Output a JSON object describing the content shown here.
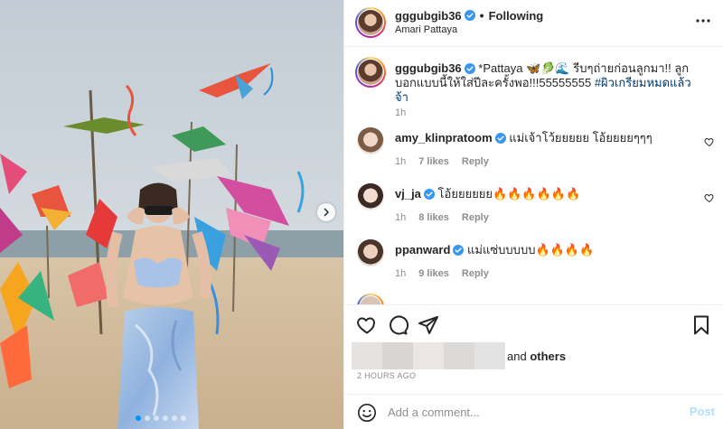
{
  "header": {
    "username": "gggubgib36",
    "separator": "•",
    "follow_status": "Following",
    "location": "Amari Pattaya"
  },
  "caption": {
    "username": "gggubgib36",
    "text": "*Pattaya 🦋🥬🌊 รีบๆถ่ายก่อนลูกมา!! ลูกบอกแบบนี้ให้ใส่ปีละครั้งพอ!!!55555555",
    "hashtag": "#ผิวเกรียมหมดแล้วจ้า",
    "time": "1h"
  },
  "comments": [
    {
      "username": "amy_klinpratoom",
      "verified": true,
      "text": "แม่เจ้าโว้ยยยยย โอ้ยยยยๆๆๆ",
      "time": "1h",
      "likes": "7 likes",
      "reply": "Reply"
    },
    {
      "username": "vj_ja",
      "verified": true,
      "text": "โอ้ยยยยยย🔥🔥🔥🔥🔥🔥",
      "time": "1h",
      "likes": "8 likes",
      "reply": "Reply"
    },
    {
      "username": "ppanward",
      "verified": true,
      "text": "แม่แซ่บบบบบ🔥🔥🔥🔥",
      "time": "1h",
      "likes": "9 likes",
      "reply": "Reply"
    }
  ],
  "likes": {
    "others_prefix": "and",
    "others": "others"
  },
  "timestamp": "2 HOURS AGO",
  "add_comment": {
    "placeholder": "Add a comment...",
    "post_label": "Post"
  },
  "carousel": {
    "count": 6,
    "active_index": 0
  },
  "icons": {
    "verified": "verified-badge-icon",
    "more": "more-options-icon",
    "like": "heart-icon",
    "comment": "comment-icon",
    "share": "paper-plane-icon",
    "save": "bookmark-icon",
    "emoji": "smiley-icon",
    "next": "chevron-right-icon"
  },
  "colors": {
    "verified": "#3897f0",
    "link": "#00376b",
    "muted": "#8e8e8e",
    "post_disabled": "#b2dffc"
  }
}
